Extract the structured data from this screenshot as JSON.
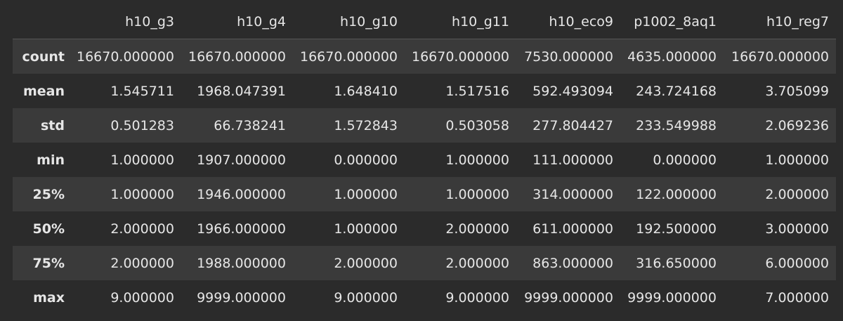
{
  "table": {
    "columns": [
      "h10_g3",
      "h10_g4",
      "h10_g10",
      "h10_g11",
      "h10_eco9",
      "p1002_8aq1",
      "h10_reg7"
    ],
    "rows": [
      {
        "label": "count",
        "values": [
          "16670.000000",
          "16670.000000",
          "16670.000000",
          "16670.000000",
          "7530.000000",
          "4635.000000",
          "16670.000000"
        ]
      },
      {
        "label": "mean",
        "values": [
          "1.545711",
          "1968.047391",
          "1.648410",
          "1.517516",
          "592.493094",
          "243.724168",
          "3.705099"
        ]
      },
      {
        "label": "std",
        "values": [
          "0.501283",
          "66.738241",
          "1.572843",
          "0.503058",
          "277.804427",
          "233.549988",
          "2.069236"
        ]
      },
      {
        "label": "min",
        "values": [
          "1.000000",
          "1907.000000",
          "0.000000",
          "1.000000",
          "111.000000",
          "0.000000",
          "1.000000"
        ]
      },
      {
        "label": "25%",
        "values": [
          "1.000000",
          "1946.000000",
          "1.000000",
          "1.000000",
          "314.000000",
          "122.000000",
          "2.000000"
        ]
      },
      {
        "label": "50%",
        "values": [
          "2.000000",
          "1966.000000",
          "1.000000",
          "2.000000",
          "611.000000",
          "192.500000",
          "3.000000"
        ]
      },
      {
        "label": "75%",
        "values": [
          "2.000000",
          "1988.000000",
          "2.000000",
          "2.000000",
          "863.000000",
          "316.650000",
          "6.000000"
        ]
      },
      {
        "label": "max",
        "values": [
          "9.000000",
          "9999.000000",
          "9.000000",
          "9.000000",
          "9999.000000",
          "9999.000000",
          "7.000000"
        ]
      }
    ]
  }
}
